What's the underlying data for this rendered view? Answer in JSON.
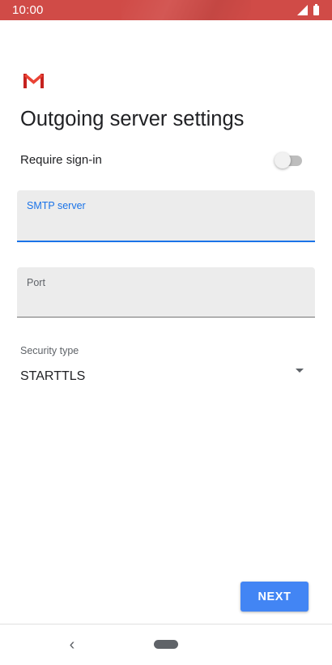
{
  "status_bar": {
    "time": "10:00",
    "icons": [
      "signal-icon",
      "battery-icon"
    ],
    "color": "#d04b47"
  },
  "app": {
    "logo": "gmail-logo",
    "title": "Outgoing server settings"
  },
  "form": {
    "require_signin": {
      "label": "Require sign-in",
      "enabled": false
    },
    "smtp_server": {
      "label": "SMTP server",
      "value": "",
      "focused": true
    },
    "port": {
      "label": "Port",
      "value": ""
    },
    "security_type": {
      "label": "Security type",
      "value": "STARTTLS"
    }
  },
  "actions": {
    "next_label": "NEXT"
  },
  "nav_bar": {
    "icons": [
      "back-icon",
      "home-icon"
    ]
  },
  "colors": {
    "accent": "#1a73e8",
    "button": "#4285f4",
    "field_bg": "#ececec"
  }
}
